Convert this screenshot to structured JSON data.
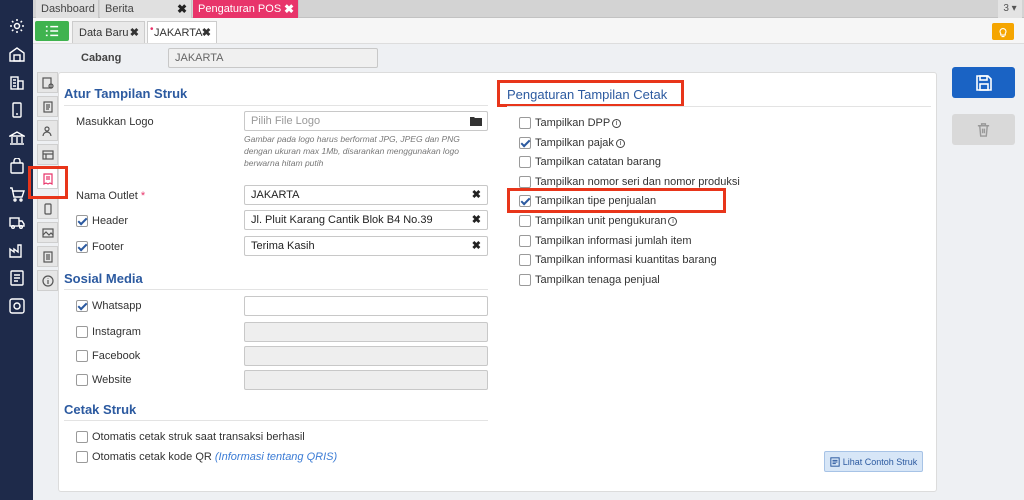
{
  "top_tabs": [
    {
      "label": "Dashboard"
    },
    {
      "label": "Berita"
    },
    {
      "label": "Pengaturan POS"
    }
  ],
  "tab_count": "3",
  "sub_tabs": [
    {
      "label": "Data Baru"
    },
    {
      "label": "JAKARTA"
    }
  ],
  "cabang": {
    "label": "Cabang",
    "value": "JAKARTA"
  },
  "struk": {
    "title": "Atur Tampilan Struk",
    "logo_label": "Masukkan Logo",
    "logo_placeholder": "Pilih File Logo",
    "logo_hint": "Gambar pada logo harus berformat JPG, JPEG dan PNG dengan ukuran max 1Mb, disarankan menggunakan logo berwarna hitam putih",
    "outlet_label": "Nama Outlet",
    "required_mark": "*",
    "outlet_value": "JAKARTA",
    "header_label": "Header",
    "header_value": "Jl. Pluit Karang Cantik Blok B4 No.39",
    "footer_label": "Footer",
    "footer_value": "Terima Kasih"
  },
  "sosmed": {
    "title": "Sosial Media",
    "items": [
      {
        "label": "Whatsapp",
        "checked": true
      },
      {
        "label": "Instagram",
        "checked": false
      },
      {
        "label": "Facebook",
        "checked": false
      },
      {
        "label": "Website",
        "checked": false
      }
    ]
  },
  "cetak": {
    "title": "Cetak Struk",
    "auto_print": "Otomatis cetak struk saat transaksi berhasil",
    "auto_qr": "Otomatis cetak kode QR",
    "qris_link": "(Informasi tentang QRIS)"
  },
  "print_settings": {
    "title": "Pengaturan Tampilan Cetak",
    "items": [
      {
        "label": "Tampilkan DPP",
        "checked": false,
        "info": true
      },
      {
        "label": "Tampilkan pajak",
        "checked": true,
        "info": true
      },
      {
        "label": "Tampilkan catatan barang",
        "checked": false
      },
      {
        "label": "Tampilkan nomor seri dan nomor produksi",
        "checked": false
      },
      {
        "label": "Tampilkan tipe penjualan",
        "checked": true
      },
      {
        "label": "Tampilkan unit pengukuran",
        "checked": false,
        "info": true
      },
      {
        "label": "Tampilkan informasi jumlah item",
        "checked": false
      },
      {
        "label": "Tampilkan informasi kuantitas barang",
        "checked": false
      },
      {
        "label": "Tampilkan tenaga penjual",
        "checked": false
      }
    ]
  },
  "preview_button": "Lihat Contoh Struk",
  "info_glyph": "i",
  "colors": {
    "accent": "#e8346a",
    "primary": "#1a63c4",
    "highlight": "#e8351a",
    "sidebar": "#1e2a4a"
  }
}
